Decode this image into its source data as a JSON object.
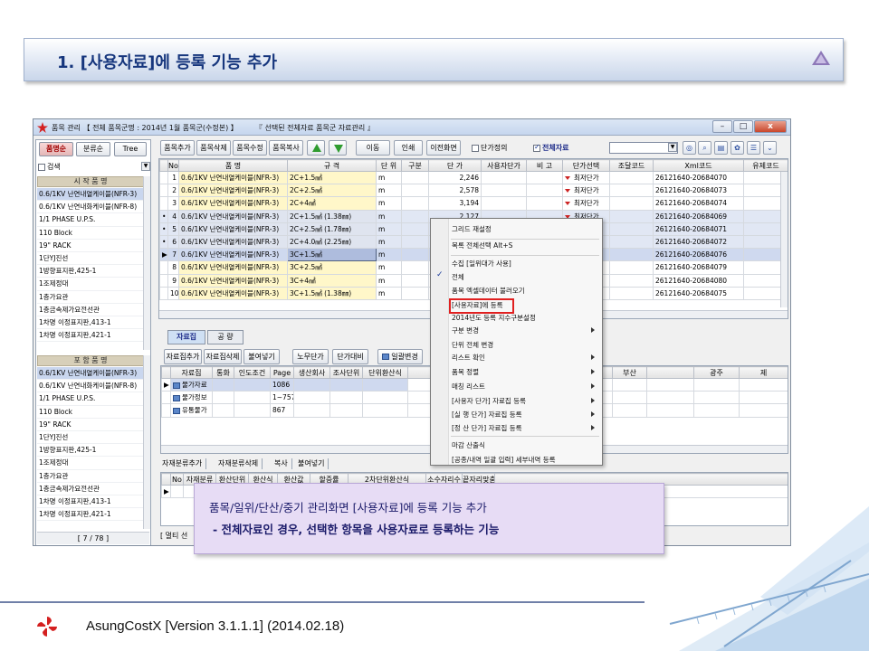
{
  "slide": {
    "title": "1. [사용자료]에 등록 기능 추가",
    "footer": "AsungCostX    [Version 3.1.1.1]    (2014.02.18)"
  },
  "app": {
    "title": "품목 관리 【 전체 품목군명 : 2014년 1월 품목군(수정본) 】",
    "title2": "『 선택된 전체자료 품목군 자료관리 』",
    "window_buttons": [
      "–",
      "□",
      "x"
    ],
    "left_panel": {
      "tabs": [
        "품명순",
        "분류순",
        "Tree"
      ],
      "search_label": "검색",
      "group1_header": "시 작 품 명",
      "group1_items": [
        "0.6/1KV 난연내열케이블(NFR-3)",
        "0.6/1KV 난연내화케이블(NFR-8)",
        "1/1 PHASE U.P.S.",
        "110 Block",
        "19\" RACK",
        "1단YJ진선",
        "1방향표지판,425-1",
        "1조제정대",
        "1층가요관",
        "1층금속제가요전선관",
        "1차명 이정표지판,413-1",
        "1차명 이정표지판,421-1"
      ],
      "group2_header": "포 함 품 명",
      "group2_items": [
        "0.6/1KV 난연내열케이블(NFR-3)",
        "0.6/1KV 난연내화케이블(NFR-8)",
        "1/1 PHASE U.P.S.",
        "110 Block",
        "19\" RACK",
        "1단YJ진선",
        "1방향표지판,425-1",
        "1조제정대",
        "1층가요관",
        "1층금속제가요전선관",
        "1차명 이정표지판,413-1",
        "1차명 이정표지판,421-1"
      ],
      "footer": "[ 7 / 78 ]"
    },
    "toolbar": {
      "buttons": [
        "품목추가",
        "품목삭제",
        "품목수정",
        "품목복사",
        "이동",
        "인쇄",
        "이전화면"
      ],
      "unit_price_def": "단가정의",
      "all_data": "전체자료"
    },
    "main_grid": {
      "headers": [
        "No",
        "품 명",
        "규 격",
        "단 위",
        "구분",
        "단 가",
        "사용자단가",
        "비 고",
        "단가선택",
        "조달코드",
        "Xml코드",
        "유제코드"
      ],
      "rows": [
        {
          "no": "1",
          "name": "0.6/1KV 난연내열케이블(NFR-3)",
          "spec": "2C+1.5㎟",
          "unit": "m",
          "price": "2,246",
          "sel": "최저단가",
          "xml": "26121640-20684070"
        },
        {
          "no": "2",
          "name": "0.6/1KV 난연내열케이블(NFR-3)",
          "spec": "2C+2.5㎟",
          "unit": "m",
          "price": "2,578",
          "sel": "최저단가",
          "xml": "26121640-20684073"
        },
        {
          "no": "3",
          "name": "0.6/1KV 난연내열케이블(NFR-3)",
          "spec": "2C+4㎟",
          "unit": "m",
          "price": "3,194",
          "sel": "최저단가",
          "xml": "26121640-20684074"
        },
        {
          "no": "4",
          "name": "0.6/1KV 난연내열케이블(NFR-3)",
          "spec": "2C+1.5㎟ (1.38㎜)",
          "unit": "m",
          "price": "2,127",
          "sel": "최저단가",
          "xml": "26121640-20684069"
        },
        {
          "no": "5",
          "name": "0.6/1KV 난연내열케이블(NFR-3)",
          "spec": "2C+2.5㎟ (1.78㎜)",
          "unit": "m",
          "price": "",
          "sel": "최저단가",
          "xml": "26121640-20684071"
        },
        {
          "no": "6",
          "name": "0.6/1KV 난연내열케이블(NFR-3)",
          "spec": "2C+4.0㎟ (2.25㎜)",
          "unit": "m",
          "price": "",
          "sel": "최저단가",
          "xml": "26121640-20684072"
        },
        {
          "no": "7",
          "name": "0.6/1KV 난연내열케이블(NFR-3)",
          "spec": "3C+1.5㎟",
          "unit": "m",
          "price": "",
          "sel": "최저단가",
          "xml": "26121640-20684076"
        },
        {
          "no": "8",
          "name": "0.6/1KV 난연내열케이블(NFR-3)",
          "spec": "3C+2.5㎟",
          "unit": "m",
          "price": "",
          "sel": "최저단가",
          "xml": "26121640-20684079"
        },
        {
          "no": "9",
          "name": "0.6/1KV 난연내열케이블(NFR-3)",
          "spec": "3C+4㎟",
          "unit": "m",
          "price": "",
          "sel": "최저단가",
          "xml": "26121640-20684080"
        },
        {
          "no": "10",
          "name": "0.6/1KV 난연내열케이블(NFR-3)",
          "spec": "3C+1.5㎟ (1.38㎜)",
          "unit": "m",
          "price": "",
          "sel": "최저단가",
          "xml": "26121640-20684075"
        }
      ]
    },
    "sub_tabs": [
      "자료집",
      "공 량"
    ],
    "sub_toolbar": [
      "자료집추가",
      "자료집삭제",
      "불여넣기",
      "노무단가",
      "단가대비",
      "일괄변경"
    ],
    "sub_grid": {
      "headers": [
        "",
        "자료집",
        "통화",
        "인도조건",
        "Page",
        "생산회사",
        "조사단위",
        "단위환산식",
        "",
        "",
        "",
        "대구",
        "",
        "부산",
        "",
        "광주",
        "제"
      ],
      "rows": [
        {
          "name": "물가자료",
          "page": "1086"
        },
        {
          "name": "물가정보",
          "page": "1~757"
        },
        {
          "name": "유통물가",
          "page": "867"
        }
      ]
    },
    "bottom_tabs": [
      "자재분류추가",
      "자재분류삭제",
      "복사",
      "불여넣기"
    ],
    "bottom_grid_headers": [
      "No",
      "자재분류",
      "환산단위",
      "환산식",
      "환산값",
      "할증률",
      "2차단위환산식",
      "소수자리수",
      "끝자리맞춤"
    ],
    "status_left": "[ 멀티 선"
  },
  "context_menu": {
    "items": [
      {
        "label": "그리드 재설정",
        "sub": false
      },
      {
        "label": "목록 전체선택 Alt+S",
        "sub": false
      },
      {
        "label": "수집 [일위대가 사용]",
        "sub": false
      },
      {
        "label": "전체",
        "sub": false,
        "checked": true
      },
      {
        "label": "품목 엑셀데이터 불러오기",
        "sub": false
      },
      {
        "label": "[사용자료]에 등록",
        "sub": false,
        "highlight": true
      },
      {
        "label": "2014년도 등록 지수구분설정",
        "sub": false
      },
      {
        "label": "구분 변경",
        "sub": true
      },
      {
        "label": "단위 전체 변경",
        "sub": false
      },
      {
        "label": "리스트 확인",
        "sub": true
      },
      {
        "label": "품목 정렬",
        "sub": true
      },
      {
        "label": "매칭 리스트",
        "sub": true
      },
      {
        "label": "[사용자 단가] 자료집 등록",
        "sub": true
      },
      {
        "label": "[실  행 단가] 자료집 등록",
        "sub": true
      },
      {
        "label": "[정  산 단가] 자료집 등록",
        "sub": true
      },
      {
        "label": "마감 산출식",
        "sub": false
      },
      {
        "label": "[공종/내역 일괄 입력] 세부내역 등록",
        "sub": false
      }
    ]
  },
  "callout": {
    "line1": "품목/일위/단산/중기 관리화면 [사용자료]에 등록 기능 추가",
    "line2": "- 전체자료인 경우, 선택한 항목을 사용자료로 등록하는 기능"
  },
  "colors": {
    "title_text": "#16367d",
    "callout_bg": "#e7dcf5",
    "highlight_border": "#e02020",
    "row_yellow": "#fff7c9",
    "row_blue": "#e1e7f4"
  }
}
